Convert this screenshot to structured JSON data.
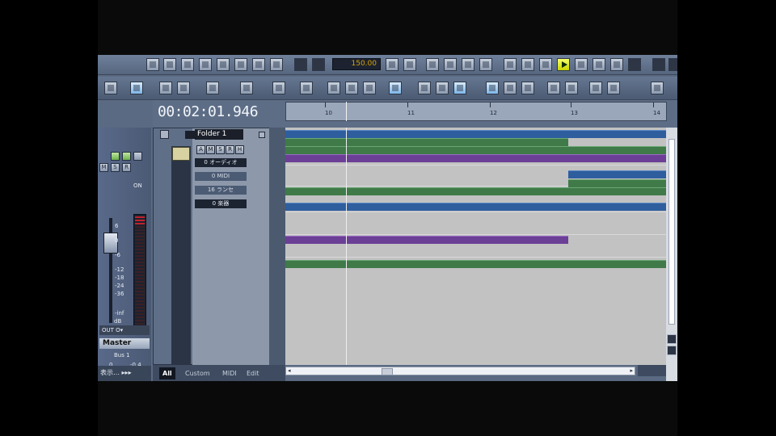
{
  "transport": {
    "tempo": "150.00",
    "timecode": "00:02:01.946"
  },
  "ruler": {
    "marks": [
      "10",
      "11",
      "12",
      "13",
      "14"
    ]
  },
  "folder": {
    "name": "Folder 1",
    "buttons": [
      "A",
      "M",
      "S",
      "R",
      "H"
    ],
    "sub_tracks": [
      "0 オーディオ",
      "0 MIDI",
      "16 ランセ",
      "0 楽器"
    ]
  },
  "mixer": {
    "scale": [
      "6",
      "0",
      "-6",
      "-12",
      "-18",
      "-24",
      "-36",
      "-inf"
    ],
    "db_unit": "dB",
    "left_value": "0",
    "right_value": "-0.4",
    "mini_buttons": [
      "M",
      "S",
      "R"
    ],
    "out_label": "OUT O▾",
    "master_label": "Master",
    "bus_label": "Bus 1",
    "pan_label": "ON"
  },
  "tabs": [
    "All",
    "Custom",
    "MIDI",
    "Edit"
  ],
  "bottom_left_label": "表示… ▸▸▸",
  "colors": {
    "blue_clip": "#2e5e9e",
    "green_clip": "#3f7a48",
    "purple_clip": "#6c3f96",
    "play_button": "#e8f200"
  }
}
